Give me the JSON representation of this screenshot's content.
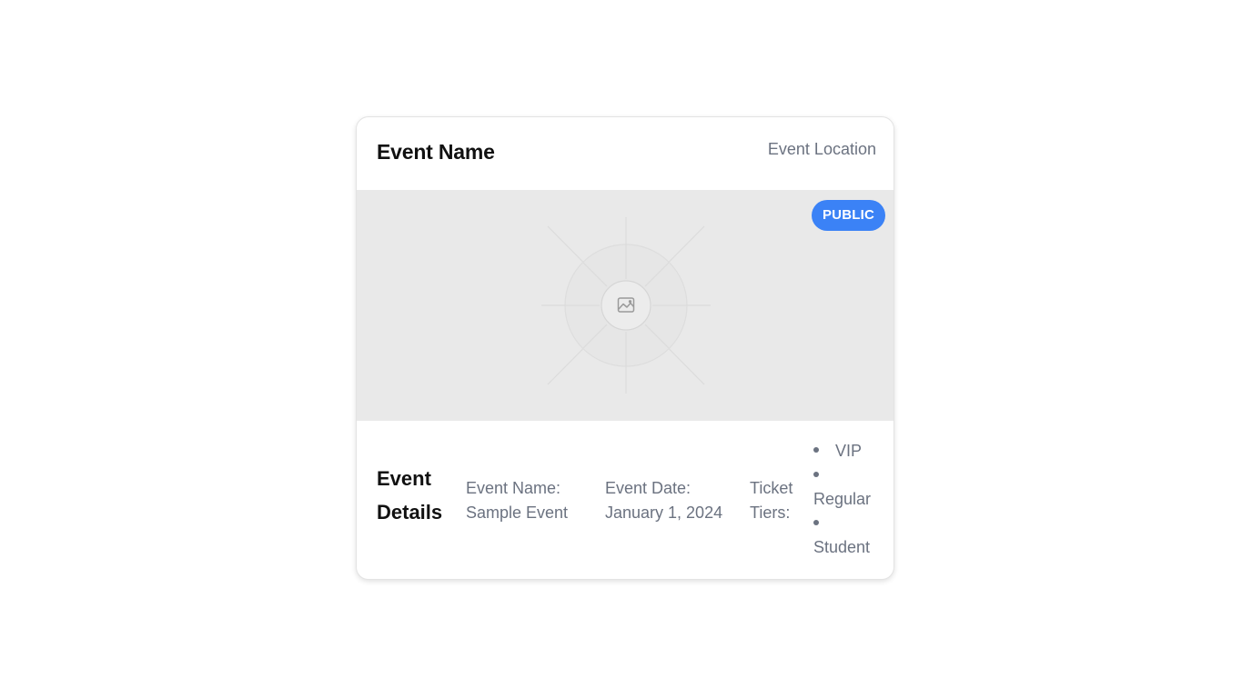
{
  "header": {
    "title": "Event Name",
    "location": "Event Location"
  },
  "media": {
    "badge": "PUBLIC",
    "placeholder_icon": "image-icon",
    "badge_color": "#3b82f6"
  },
  "details": {
    "heading": "Event Details",
    "event_name_label": "Event Name:",
    "event_name_value": "Sample Event",
    "event_date_label": "Event Date:",
    "event_date_value": "January 1, 2024",
    "tiers_label": "Ticket Tiers:",
    "tiers": [
      "VIP",
      "Regular",
      "Student"
    ]
  }
}
